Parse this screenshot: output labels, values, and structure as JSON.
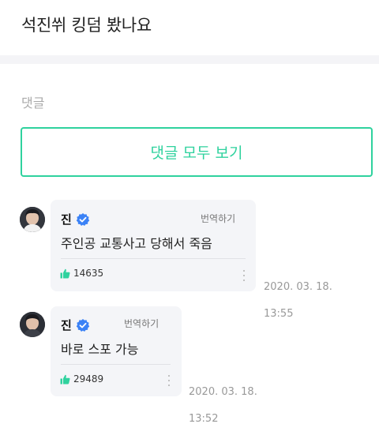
{
  "post": {
    "title": "석진쒸 킹덤 봤나요"
  },
  "comments_section": {
    "label": "댓글",
    "view_all_label": "댓글 모두 보기"
  },
  "comments": [
    {
      "author": "진",
      "verified": true,
      "translate_label": "번역하기",
      "text": "주인공 교통사고 당해서 죽음",
      "likes": "14635",
      "date": "2020. 03. 18.",
      "time": "13:55"
    },
    {
      "author": "진",
      "verified": true,
      "translate_label": "번역하기",
      "text": "바로 스포 가능",
      "likes": "29489",
      "date": "2020. 03. 18.",
      "time": "13:52"
    }
  ],
  "icons": {
    "verified": "verified-badge-icon",
    "like": "thumbs-up-icon",
    "more": "vertical-dots-icon"
  },
  "colors": {
    "accent": "#2fd29e",
    "verified": "#3b82f6",
    "bubble": "#f4f5f8"
  }
}
